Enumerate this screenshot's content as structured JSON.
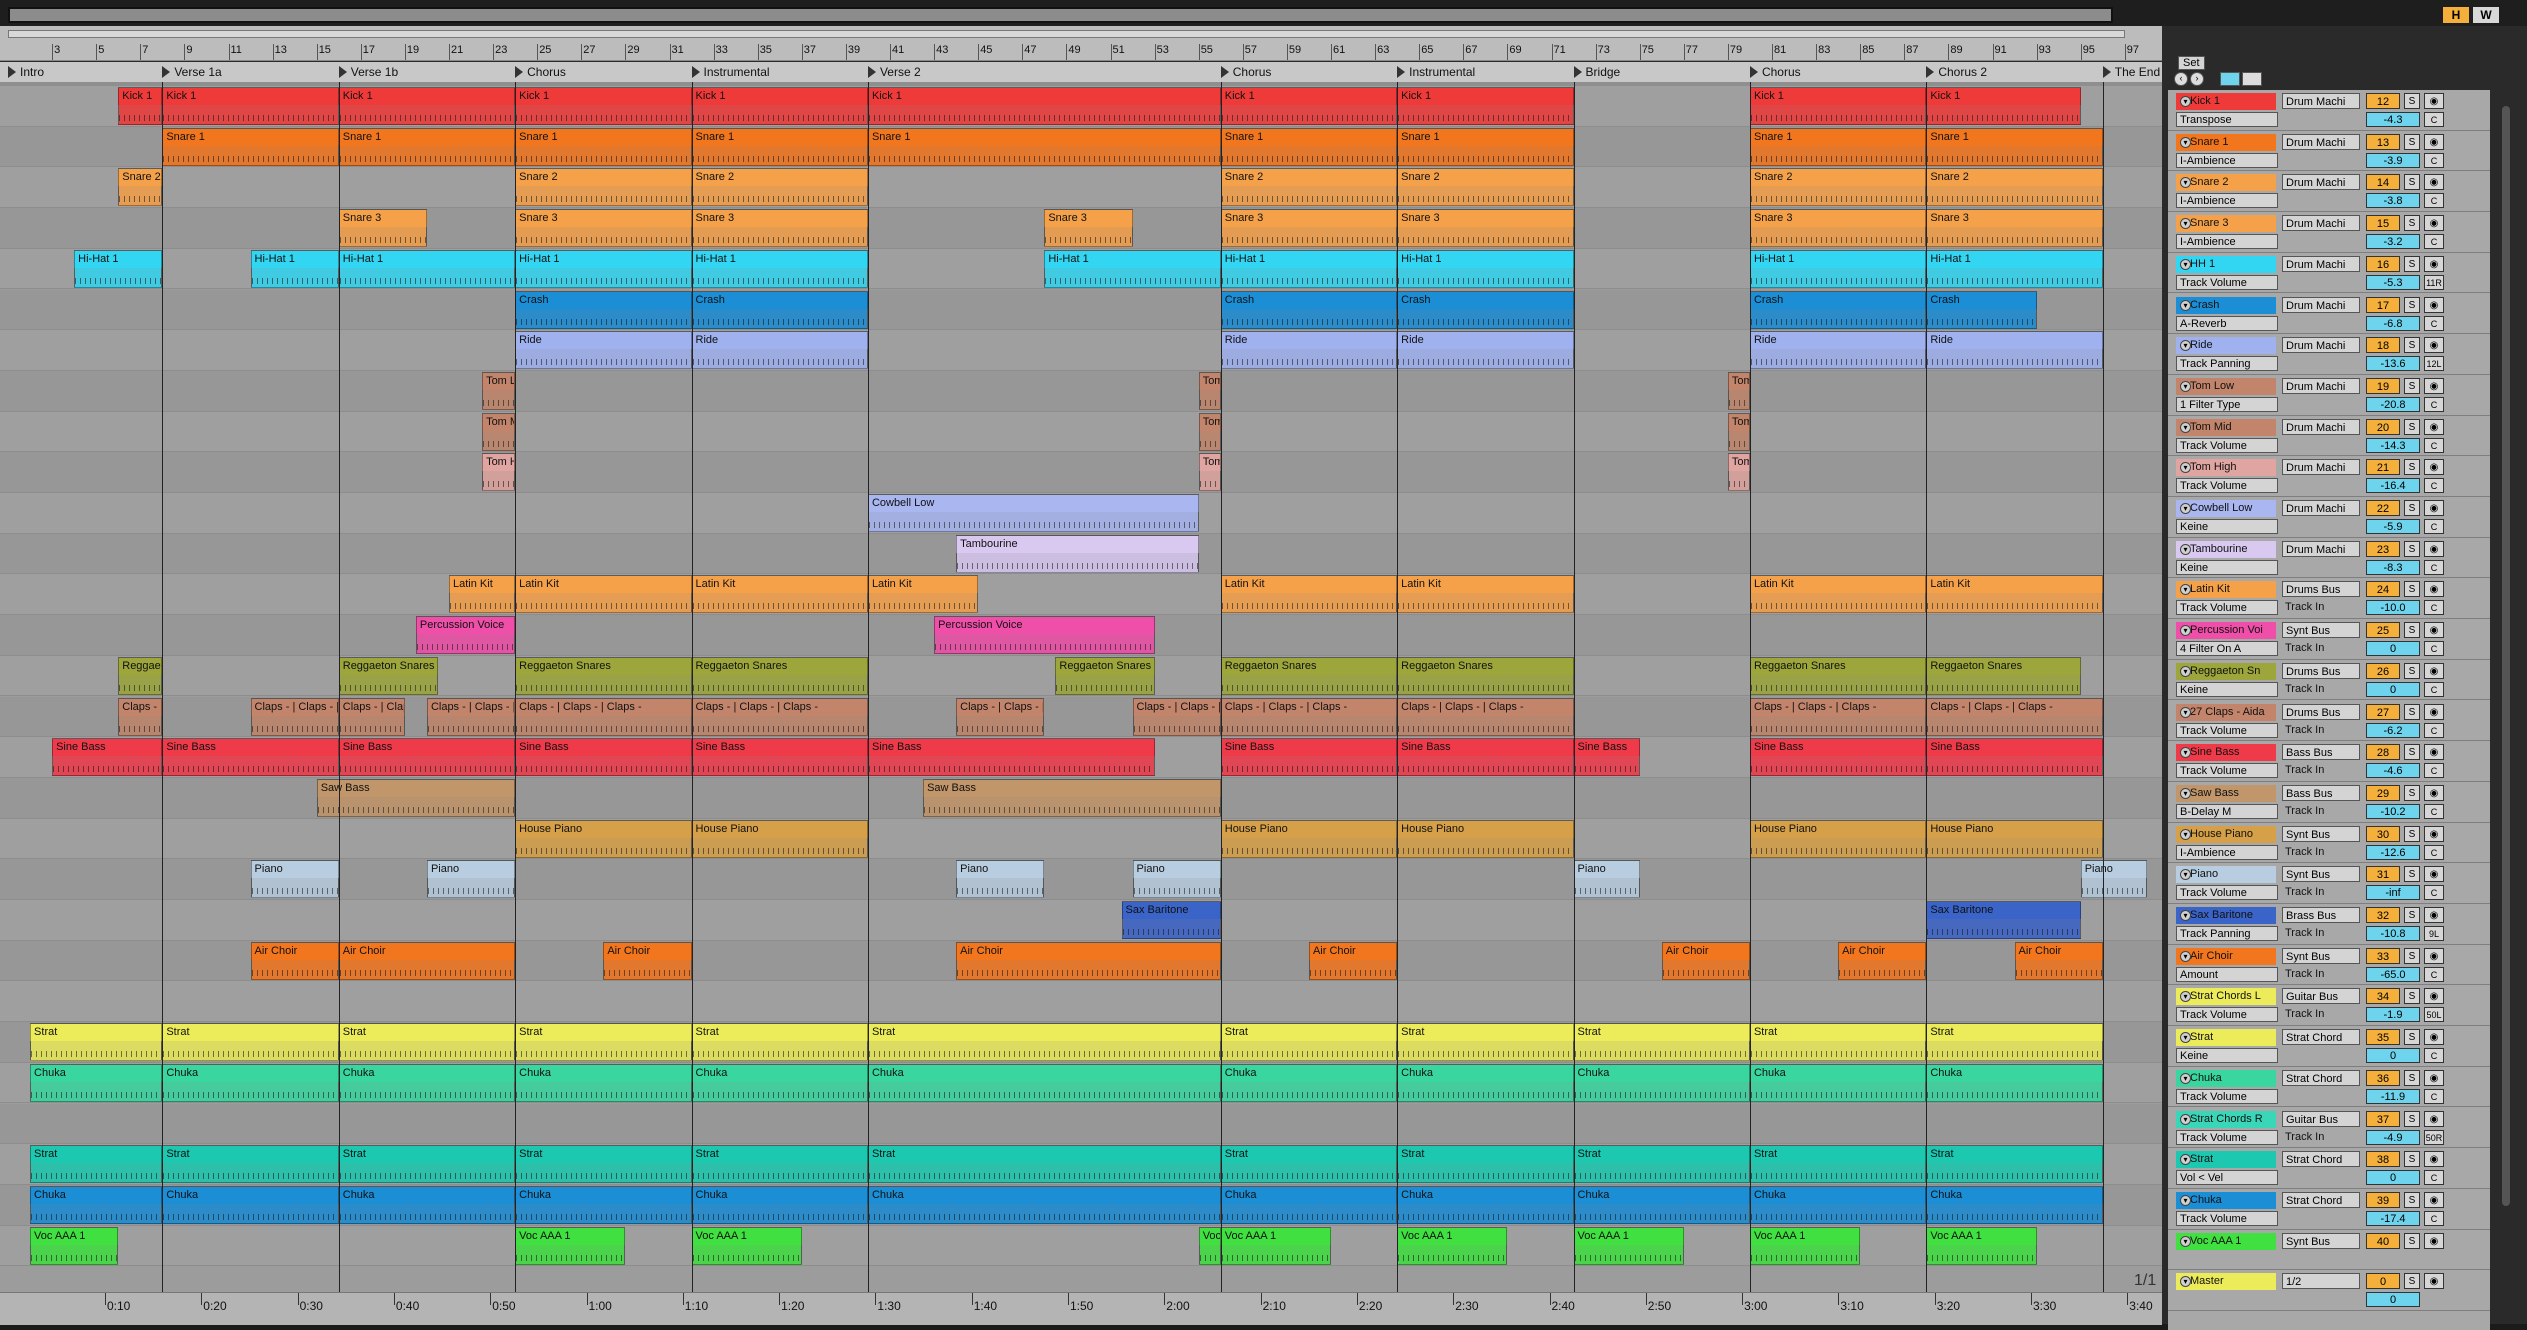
{
  "overview": {
    "h_label": "H",
    "w_label": "W"
  },
  "bars": [
    3,
    5,
    7,
    9,
    11,
    13,
    15,
    17,
    19,
    21,
    23,
    25,
    27,
    29,
    31,
    33,
    35,
    37,
    39,
    41,
    43,
    45,
    47,
    49,
    51,
    53,
    55,
    57,
    59,
    61,
    63,
    65,
    67,
    69,
    71,
    73,
    75,
    77,
    79,
    81,
    83,
    85,
    87,
    89,
    91,
    93,
    95,
    97
  ],
  "locators": [
    "Intro",
    "Verse 1a",
    "Verse 1b",
    "Chorus",
    "Instrumental",
    "Verse 2",
    "Chorus",
    "Instrumental",
    "Bridge",
    "Chorus",
    "Chorus 2",
    "The End"
  ],
  "mixer_header": {
    "set_label": "Set"
  },
  "tracks": [
    {
      "name": "Kick 1",
      "device": "Transpose",
      "route": "Drum Machi",
      "input": "",
      "num": "12",
      "vol": "-4.3",
      "pan": "C",
      "color": "#ef3a3a"
    },
    {
      "name": "Snare 1",
      "device": "I-Ambience",
      "route": "Drum Machi",
      "input": "",
      "num": "13",
      "vol": "-3.9",
      "pan": "C",
      "color": "#f2761e"
    },
    {
      "name": "Snare 2",
      "device": "I-Ambience",
      "route": "Drum Machi",
      "input": "",
      "num": "14",
      "vol": "-3.8",
      "pan": "C",
      "color": "#f4a14a"
    },
    {
      "name": "Snare 3",
      "device": "I-Ambience",
      "route": "Drum Machi",
      "input": "",
      "num": "15",
      "vol": "-3.2",
      "pan": "C",
      "color": "#f4a14a"
    },
    {
      "name": "HH 1",
      "device": "Track Volume",
      "route": "Drum Machi",
      "input": "",
      "num": "16",
      "vol": "-5.3",
      "pan": "11R",
      "color": "#33d6f2"
    },
    {
      "name": "Crash",
      "device": "A-Reverb",
      "route": "Drum Machi",
      "input": "",
      "num": "17",
      "vol": "-6.8",
      "pan": "C",
      "color": "#1c8ed6"
    },
    {
      "name": "Ride",
      "device": "Track Panning",
      "route": "Drum Machi",
      "input": "",
      "num": "18",
      "vol": "-13.6",
      "pan": "12L",
      "color": "#9fb2ef"
    },
    {
      "name": "Tom Low",
      "device": "1 Filter Type",
      "route": "Drum Machi",
      "input": "",
      "num": "19",
      "vol": "-20.8",
      "pan": "C",
      "color": "#c2856b"
    },
    {
      "name": "Tom Mid",
      "device": "Track Volume",
      "route": "Drum Machi",
      "input": "",
      "num": "20",
      "vol": "-14.3",
      "pan": "C",
      "color": "#c2856b"
    },
    {
      "name": "Tom High",
      "device": "Track Volume",
      "route": "Drum Machi",
      "input": "",
      "num": "21",
      "vol": "-16.4",
      "pan": "C",
      "color": "#e0a5a0"
    },
    {
      "name": "Cowbell Low",
      "device": "Keine",
      "route": "Drum Machi",
      "input": "",
      "num": "22",
      "vol": "-5.9",
      "pan": "C",
      "color": "#a9b6f0"
    },
    {
      "name": "Tambourine",
      "device": "Keine",
      "route": "Drum Machi",
      "input": "",
      "num": "23",
      "vol": "-8.3",
      "pan": "C",
      "color": "#d9c8f0"
    },
    {
      "name": "Latin Kit",
      "device": "Track Volume",
      "route": "Drums Bus",
      "input": "Track In",
      "num": "24",
      "vol": "-10.0",
      "pan": "C",
      "color": "#f4a14a"
    },
    {
      "name": "Percussion Voi",
      "device": "4 Filter On A",
      "route": "Synt Bus",
      "input": "Track In",
      "num": "25",
      "vol": "0",
      "pan": "C",
      "color": "#ef4fa8"
    },
    {
      "name": "Reggaeton Sn",
      "device": "Keine",
      "route": "Drums Bus",
      "input": "Track In",
      "num": "26",
      "vol": "0",
      "pan": "C",
      "color": "#9ca63a"
    },
    {
      "name": "27 Claps - Aida",
      "device": "Track Volume",
      "route": "Drums Bus",
      "input": "Track In",
      "num": "27",
      "vol": "-6.2",
      "pan": "C",
      "color": "#c2856b"
    },
    {
      "name": "Sine Bass",
      "device": "Track Volume",
      "route": "Bass Bus",
      "input": "Track In",
      "num": "28",
      "vol": "-4.6",
      "pan": "C",
      "color": "#ef3a4a"
    },
    {
      "name": "Saw Bass",
      "device": "B-Delay M",
      "route": "Bass Bus",
      "input": "Track In",
      "num": "29",
      "vol": "-10.2",
      "pan": "C",
      "color": "#c2966b"
    },
    {
      "name": "House Piano",
      "device": "I-Ambience",
      "route": "Synt Bus",
      "input": "Track In",
      "num": "30",
      "vol": "-12.6",
      "pan": "C",
      "color": "#d6a048"
    },
    {
      "name": "Piano",
      "device": "Track Volume",
      "route": "Synt Bus",
      "input": "Track In",
      "num": "31",
      "vol": "-inf",
      "pan": "C",
      "color": "#b8cde0"
    },
    {
      "name": "Sax Baritone",
      "device": "Track Panning",
      "route": "Brass Bus",
      "input": "Track In",
      "num": "32",
      "vol": "-10.8",
      "pan": "9L",
      "color": "#3a64c8"
    },
    {
      "name": "Air Choir",
      "device": "Amount",
      "route": "Synt Bus",
      "input": "Track In",
      "num": "33",
      "vol": "-65.0",
      "pan": "C",
      "color": "#f2761e"
    },
    {
      "name": "Strat Chords L",
      "device": "Track Volume",
      "route": "Guitar Bus",
      "input": "Track In",
      "num": "34",
      "vol": "-1.9",
      "pan": "50L",
      "color": "#ecec5a"
    },
    {
      "name": "Strat",
      "device": "Keine",
      "route": "Strat Chord",
      "input": "",
      "num": "35",
      "vol": "0",
      "pan": "C",
      "color": "#ecec5a"
    },
    {
      "name": "Chuka",
      "device": "Track Volume",
      "route": "Strat Chord",
      "input": "",
      "num": "36",
      "vol": "-11.9",
      "pan": "C",
      "color": "#3ad6a0"
    },
    {
      "name": "Strat Chords R",
      "device": "Track Volume",
      "route": "Guitar Bus",
      "input": "Track In",
      "num": "37",
      "vol": "-4.9",
      "pan": "50R",
      "color": "#3ad6b8"
    },
    {
      "name": "Strat",
      "device": "Vol < Vel",
      "route": "Strat Chord",
      "input": "",
      "num": "38",
      "vol": "0",
      "pan": "C",
      "color": "#1cc8b0"
    },
    {
      "name": "Chuka",
      "device": "Track Volume",
      "route": "Strat Chord",
      "input": "",
      "num": "39",
      "vol": "-17.4",
      "pan": "C",
      "color": "#1c8ed6"
    },
    {
      "name": "Voc AAA 1",
      "device": "",
      "route": "Synt Bus",
      "input": "",
      "num": "40",
      "vol": "",
      "pan": "",
      "color": "#40e040"
    },
    {
      "name": "Master",
      "device": "",
      "route": "1/2",
      "input": "",
      "num": "0",
      "vol": "0",
      "pan": "",
      "color": "#ecec5a"
    }
  ],
  "clip_labels": {
    "kick": "Kick 1",
    "snare1": "Snare 1",
    "snare2": "Snare 2",
    "snare3": "Snare 3",
    "hh": "Hi-Hat 1",
    "crash": "Crash",
    "ride": "Ride",
    "toml": "Tom L",
    "tomm": "Tom M",
    "tomh": "Tom H",
    "cowbell": "Cowbell Low",
    "tamb": "Tambourine",
    "latin": "Latin Kit",
    "perc": "Percussion Voice",
    "regg": "Reggaeton Snares",
    "claps": "Claps - | Claps - | Claps -",
    "sine": "Sine Bass",
    "saw": "Saw Bass",
    "house": "House Piano",
    "piano": "Piano",
    "sax": "Sax Baritone",
    "air": "Air Choir",
    "strat": "Strat",
    "chuka": "Chuka",
    "voc": "Voc AAA 1"
  },
  "time_labels": [
    "0:10",
    "0:20",
    "0:30",
    "0:40",
    "0:50",
    "1:00",
    "1:10",
    "1:20",
    "1:30",
    "1:40",
    "1:50",
    "2:00",
    "2:10",
    "2:20",
    "2:30",
    "2:40",
    "2:50",
    "3:00",
    "3:10",
    "3:20",
    "3:30",
    "3:40"
  ],
  "page_indicator": "1/1",
  "colors": {
    "selected_track": "#ef3a3a",
    "ruler": "#bcbcbc",
    "lane": "#9f9f9f"
  }
}
